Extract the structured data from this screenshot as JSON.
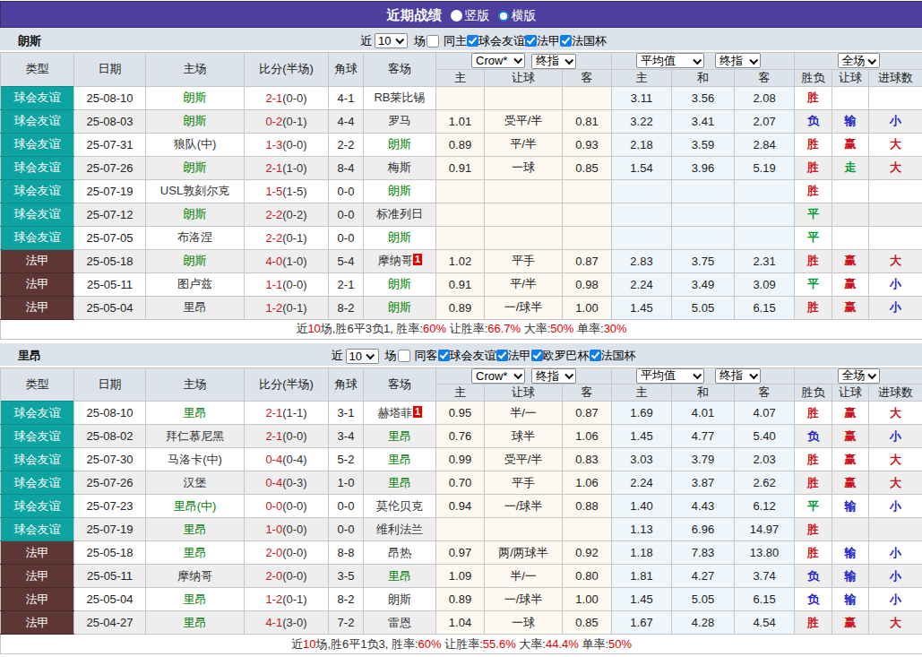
{
  "page": {
    "title": "近期战绩",
    "radio_options": [
      {
        "label": "竖版",
        "checked": false
      },
      {
        "label": "横版",
        "checked": true
      }
    ]
  },
  "colors": {
    "header_purple": "#4e3f9e",
    "bar_bg": "#dce3ea",
    "friendly_teal": "#0ca3a1",
    "league_maroon": "#5e3636",
    "row_alt_gray": "#eeeeee",
    "crow_col_tint": "#fdf8f0",
    "avg_col_tint": "#eff6fb",
    "win_red": "#c9151e",
    "lose_blue": "#2222cc",
    "draw_green": "#008000",
    "badge_red": "#e60000",
    "checkbox_blue": "#0f7ee8"
  },
  "table_header": {
    "static_cols": [
      "类型",
      "日期",
      "主场",
      "比分(半场)",
      "角球",
      "客场"
    ],
    "groups": [
      {
        "selects": [
          "Crow*",
          "终指"
        ],
        "subs": [
          "主",
          "让球",
          "客"
        ]
      },
      {
        "selects": [
          "平均值",
          "终指"
        ],
        "subs": [
          "主",
          "和",
          "客"
        ]
      },
      {
        "selects": [
          "全场"
        ],
        "subs": [
          "胜负",
          "让球",
          "进球数"
        ]
      }
    ]
  },
  "sections": [
    {
      "team": "朗斯",
      "filters": {
        "near_label": "近",
        "count": "10",
        "games_label": "场",
        "same_label": "同主",
        "same_checked": false,
        "leagues": [
          {
            "label": "球会友谊",
            "checked": true
          },
          {
            "label": "法甲",
            "checked": true
          },
          {
            "label": "法国杯",
            "checked": true
          }
        ]
      },
      "rows": [
        {
          "type": "球会友谊",
          "ts": "t1",
          "date": "25-08-10",
          "home": "朗斯",
          "hg": true,
          "score": "2-1",
          "half": "(0-0)",
          "corner": "4-1",
          "away": "RB莱比锡",
          "ag": false,
          "ab": "",
          "crow": [
            "",
            "",
            ""
          ],
          "avg": [
            "3.11",
            "3.56",
            "2.08"
          ],
          "wdl": [
            "胜",
            "r"
          ],
          "hc": [
            "",
            ""
          ],
          "ou": [
            "",
            ""
          ]
        },
        {
          "type": "球会友谊",
          "ts": "t1",
          "date": "25-08-03",
          "home": "朗斯",
          "hg": true,
          "score": "0-2",
          "half": "(0-1)",
          "corner": "4-4",
          "away": "罗马",
          "ag": false,
          "ab": "",
          "crow": [
            "1.01",
            "受平/半",
            "0.81"
          ],
          "avg": [
            "3.22",
            "3.41",
            "2.07"
          ],
          "wdl": [
            "负",
            "b"
          ],
          "hc": [
            "输",
            "b"
          ],
          "ou": [
            "小",
            "b"
          ]
        },
        {
          "type": "球会友谊",
          "ts": "t1",
          "date": "25-07-31",
          "home": "狼队(中)",
          "hg": false,
          "score": "1-3",
          "half": "(0-0)",
          "corner": "2-2",
          "away": "朗斯",
          "ag": true,
          "ab": "",
          "crow": [
            "0.89",
            "平/半",
            "0.93"
          ],
          "avg": [
            "2.18",
            "3.59",
            "2.84"
          ],
          "wdl": [
            "胜",
            "r"
          ],
          "hc": [
            "赢",
            "r"
          ],
          "ou": [
            "大",
            "r"
          ]
        },
        {
          "type": "球会友谊",
          "ts": "t1",
          "date": "25-07-26",
          "home": "朗斯",
          "hg": true,
          "score": "2-1",
          "half": "(1-0)",
          "corner": "8-4",
          "away": "梅斯",
          "ag": false,
          "ab": "",
          "crow": [
            "0.91",
            "一球",
            "0.85"
          ],
          "avg": [
            "1.54",
            "3.96",
            "5.19"
          ],
          "wdl": [
            "胜",
            "r"
          ],
          "hc": [
            "走",
            "g"
          ],
          "ou": [
            "大",
            "r"
          ]
        },
        {
          "type": "球会友谊",
          "ts": "t1",
          "date": "25-07-19",
          "home": "USL敦刻尔克",
          "hg": false,
          "score": "1-5",
          "half": "(1-5)",
          "corner": "0-0",
          "away": "朗斯",
          "ag": true,
          "ab": "",
          "crow": [
            "",
            "",
            ""
          ],
          "avg": [
            "",
            "",
            ""
          ],
          "wdl": [
            "胜",
            "r"
          ],
          "hc": [
            "",
            ""
          ],
          "ou": [
            "",
            ""
          ]
        },
        {
          "type": "球会友谊",
          "ts": "t1",
          "date": "25-07-12",
          "home": "朗斯",
          "hg": true,
          "score": "2-2",
          "half": "(0-2)",
          "corner": "0-0",
          "away": "标准列日",
          "ag": false,
          "ab": "",
          "crow": [
            "",
            "",
            ""
          ],
          "avg": [
            "",
            "",
            ""
          ],
          "wdl": [
            "平",
            "g"
          ],
          "hc": [
            "",
            ""
          ],
          "ou": [
            "",
            ""
          ]
        },
        {
          "type": "球会友谊",
          "ts": "t1",
          "date": "25-07-05",
          "home": "布洛涅",
          "hg": false,
          "score": "2-2",
          "half": "(0-1)",
          "corner": "0-0",
          "away": "朗斯",
          "ag": true,
          "ab": "",
          "crow": [
            "",
            "",
            ""
          ],
          "avg": [
            "",
            "",
            ""
          ],
          "wdl": [
            "平",
            "g"
          ],
          "hc": [
            "",
            ""
          ],
          "ou": [
            "",
            ""
          ]
        },
        {
          "type": "法甲",
          "ts": "t2",
          "date": "25-05-18",
          "home": "朗斯",
          "hg": true,
          "score": "4-0",
          "half": "(1-0)",
          "corner": "5-4",
          "away": "摩纳哥",
          "ag": false,
          "ab": "1",
          "crow": [
            "1.02",
            "平手",
            "0.87"
          ],
          "avg": [
            "2.83",
            "3.75",
            "2.31"
          ],
          "wdl": [
            "胜",
            "r"
          ],
          "hc": [
            "赢",
            "r"
          ],
          "ou": [
            "大",
            "r"
          ]
        },
        {
          "type": "法甲",
          "ts": "t2",
          "date": "25-05-11",
          "home": "图卢兹",
          "hg": false,
          "score": "1-1",
          "half": "(0-0)",
          "corner": "2-1",
          "away": "朗斯",
          "ag": true,
          "ab": "",
          "crow": [
            "0.91",
            "平/半",
            "0.98"
          ],
          "avg": [
            "2.24",
            "3.49",
            "3.09"
          ],
          "wdl": [
            "平",
            "g"
          ],
          "hc": [
            "赢",
            "r"
          ],
          "ou": [
            "小",
            "b"
          ]
        },
        {
          "type": "法甲",
          "ts": "t2",
          "date": "25-05-04",
          "home": "里昂",
          "hg": false,
          "score": "1-2",
          "half": "(0-1)",
          "corner": "8-2",
          "away": "朗斯",
          "ag": true,
          "ab": "",
          "crow": [
            "0.89",
            "一/球半",
            "1.00"
          ],
          "avg": [
            "1.45",
            "5.05",
            "6.15"
          ],
          "wdl": [
            "胜",
            "r"
          ],
          "hc": [
            "赢",
            "r"
          ],
          "ou": [
            "小",
            "b"
          ]
        }
      ],
      "summary": [
        [
          "近",
          "k"
        ],
        [
          "10",
          "r"
        ],
        [
          "场,胜6平3负1, 胜率:",
          "k"
        ],
        [
          "60%",
          "r"
        ],
        [
          " 让胜率:",
          "k"
        ],
        [
          "66.7%",
          "r"
        ],
        [
          " 大率:",
          "k"
        ],
        [
          "50%",
          "r"
        ],
        [
          " 单率:",
          "k"
        ],
        [
          "30%",
          "r"
        ]
      ]
    },
    {
      "team": "里昂",
      "filters": {
        "near_label": "近",
        "count": "10",
        "games_label": "场",
        "same_label": "同客",
        "same_checked": false,
        "leagues": [
          {
            "label": "球会友谊",
            "checked": true
          },
          {
            "label": "法甲",
            "checked": true
          },
          {
            "label": "欧罗巴杯",
            "checked": true
          },
          {
            "label": "法国杯",
            "checked": true
          }
        ]
      },
      "rows": [
        {
          "type": "球会友谊",
          "ts": "t1",
          "date": "25-08-10",
          "home": "里昂",
          "hg": true,
          "score": "2-1",
          "half": "(1-1)",
          "corner": "3-1",
          "away": "赫塔菲",
          "ag": false,
          "ab": "1",
          "crow": [
            "0.95",
            "半/一",
            "0.87"
          ],
          "avg": [
            "1.69",
            "4.01",
            "4.07"
          ],
          "wdl": [
            "胜",
            "r"
          ],
          "hc": [
            "赢",
            "r"
          ],
          "ou": [
            "大",
            "r"
          ]
        },
        {
          "type": "球会友谊",
          "ts": "t1",
          "date": "25-08-02",
          "home": "拜仁慕尼黑",
          "hg": false,
          "score": "2-1",
          "half": "(0-0)",
          "corner": "3-4",
          "away": "里昂",
          "ag": true,
          "ab": "",
          "crow": [
            "0.76",
            "球半",
            "1.06"
          ],
          "avg": [
            "1.45",
            "4.77",
            "5.40"
          ],
          "wdl": [
            "负",
            "b"
          ],
          "hc": [
            "赢",
            "r"
          ],
          "ou": [
            "小",
            "b"
          ]
        },
        {
          "type": "球会友谊",
          "ts": "t1",
          "date": "25-07-30",
          "home": "马洛卡(中)",
          "hg": false,
          "score": "0-4",
          "half": "(0-4)",
          "corner": "5-2",
          "away": "里昂",
          "ag": true,
          "ab": "",
          "crow": [
            "0.99",
            "受平/半",
            "0.83"
          ],
          "avg": [
            "3.03",
            "3.79",
            "2.03"
          ],
          "wdl": [
            "胜",
            "r"
          ],
          "hc": [
            "赢",
            "r"
          ],
          "ou": [
            "大",
            "r"
          ]
        },
        {
          "type": "球会友谊",
          "ts": "t1",
          "date": "25-07-26",
          "home": "汉堡",
          "hg": false,
          "score": "0-4",
          "half": "(0-3)",
          "corner": "1-0",
          "away": "里昂",
          "ag": true,
          "ab": "",
          "crow": [
            "0.70",
            "平手",
            "1.06"
          ],
          "avg": [
            "2.24",
            "3.87",
            "2.62"
          ],
          "wdl": [
            "胜",
            "r"
          ],
          "hc": [
            "赢",
            "r"
          ],
          "ou": [
            "大",
            "r"
          ]
        },
        {
          "type": "球会友谊",
          "ts": "t1",
          "date": "25-07-23",
          "home": "里昂(中)",
          "hg": true,
          "score": "0-0",
          "half": "(0-0)",
          "corner": "0-0",
          "away": "莫伦贝克",
          "ag": false,
          "ab": "",
          "crow": [
            "0.94",
            "一/球半",
            "0.88"
          ],
          "avg": [
            "1.40",
            "4.43",
            "6.12"
          ],
          "wdl": [
            "平",
            "g"
          ],
          "hc": [
            "输",
            "b"
          ],
          "ou": [
            "小",
            "b"
          ]
        },
        {
          "type": "球会友谊",
          "ts": "t1",
          "date": "25-07-19",
          "home": "里昂",
          "hg": true,
          "score": "1-0",
          "half": "(0-0)",
          "corner": "0-0",
          "away": "维利法兰",
          "ag": false,
          "ab": "",
          "crow": [
            "",
            "",
            ""
          ],
          "avg": [
            "1.13",
            "6.96",
            "14.97"
          ],
          "wdl": [
            "胜",
            "r"
          ],
          "hc": [
            "",
            ""
          ],
          "ou": [
            "",
            ""
          ]
        },
        {
          "type": "法甲",
          "ts": "t2",
          "date": "25-05-18",
          "home": "里昂",
          "hg": true,
          "score": "2-0",
          "half": "(0-0)",
          "corner": "8-8",
          "away": "昂热",
          "ag": false,
          "ab": "",
          "crow": [
            "0.97",
            "两/两球半",
            "0.92"
          ],
          "avg": [
            "1.18",
            "7.83",
            "13.80"
          ],
          "wdl": [
            "胜",
            "r"
          ],
          "hc": [
            "输",
            "b"
          ],
          "ou": [
            "小",
            "b"
          ]
        },
        {
          "type": "法甲",
          "ts": "t2",
          "date": "25-05-11",
          "home": "摩纳哥",
          "hg": false,
          "score": "2-0",
          "half": "(0-0)",
          "corner": "3-5",
          "away": "里昂",
          "ag": true,
          "ab": "",
          "crow": [
            "1.09",
            "半/一",
            "0.80"
          ],
          "avg": [
            "1.81",
            "4.27",
            "3.74"
          ],
          "wdl": [
            "负",
            "b"
          ],
          "hc": [
            "输",
            "b"
          ],
          "ou": [
            "小",
            "b"
          ]
        },
        {
          "type": "法甲",
          "ts": "t2",
          "date": "25-05-04",
          "home": "里昂",
          "hg": true,
          "score": "1-2",
          "half": "(0-1)",
          "corner": "8-2",
          "away": "朗斯",
          "ag": false,
          "ab": "",
          "crow": [
            "0.89",
            "一/球半",
            "1.00"
          ],
          "avg": [
            "1.45",
            "5.05",
            "6.15"
          ],
          "wdl": [
            "负",
            "b"
          ],
          "hc": [
            "输",
            "b"
          ],
          "ou": [
            "小",
            "b"
          ]
        },
        {
          "type": "法甲",
          "ts": "t2",
          "date": "25-04-27",
          "home": "里昂",
          "hg": true,
          "score": "4-1",
          "half": "(3-0)",
          "corner": "7-2",
          "away": "雷恩",
          "ag": false,
          "ab": "",
          "crow": [
            "1.04",
            "一球",
            "0.85"
          ],
          "avg": [
            "1.67",
            "4.28",
            "4.54"
          ],
          "wdl": [
            "胜",
            "r"
          ],
          "hc": [
            "赢",
            "r"
          ],
          "ou": [
            "大",
            "r"
          ]
        }
      ],
      "summary": [
        [
          "近",
          "k"
        ],
        [
          "10",
          "r"
        ],
        [
          "场,胜6平1负3, 胜率:",
          "k"
        ],
        [
          "60%",
          "r"
        ],
        [
          " 让胜率:",
          "k"
        ],
        [
          "55.6%",
          "r"
        ],
        [
          " 大率:",
          "k"
        ],
        [
          "44.4%",
          "r"
        ],
        [
          " 单率:",
          "k"
        ],
        [
          "50%",
          "r"
        ]
      ]
    }
  ]
}
